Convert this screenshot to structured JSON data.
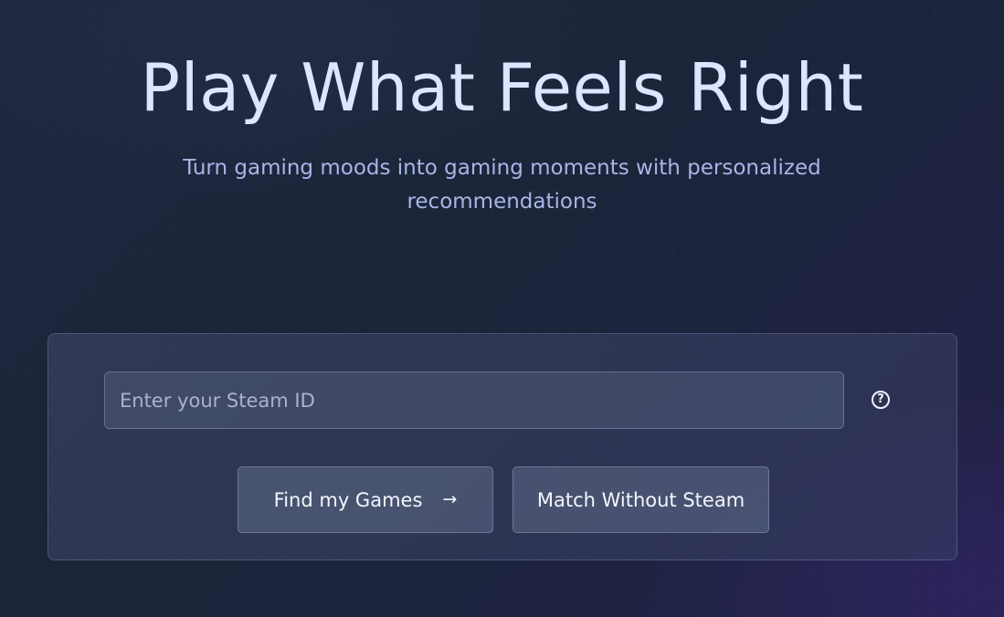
{
  "hero": {
    "title": "Play What Feels Right",
    "subtitle": "Turn gaming moods into gaming moments with personalized recommendations"
  },
  "search": {
    "placeholder": "Enter your Steam ID",
    "value": "",
    "help_icon": "question-circle-icon",
    "help_glyph": "?"
  },
  "actions": {
    "find_label": "Find my Games",
    "find_icon": "arrow-right-icon",
    "find_icon_glyph": "→",
    "match_label": "Match Without Steam"
  }
}
